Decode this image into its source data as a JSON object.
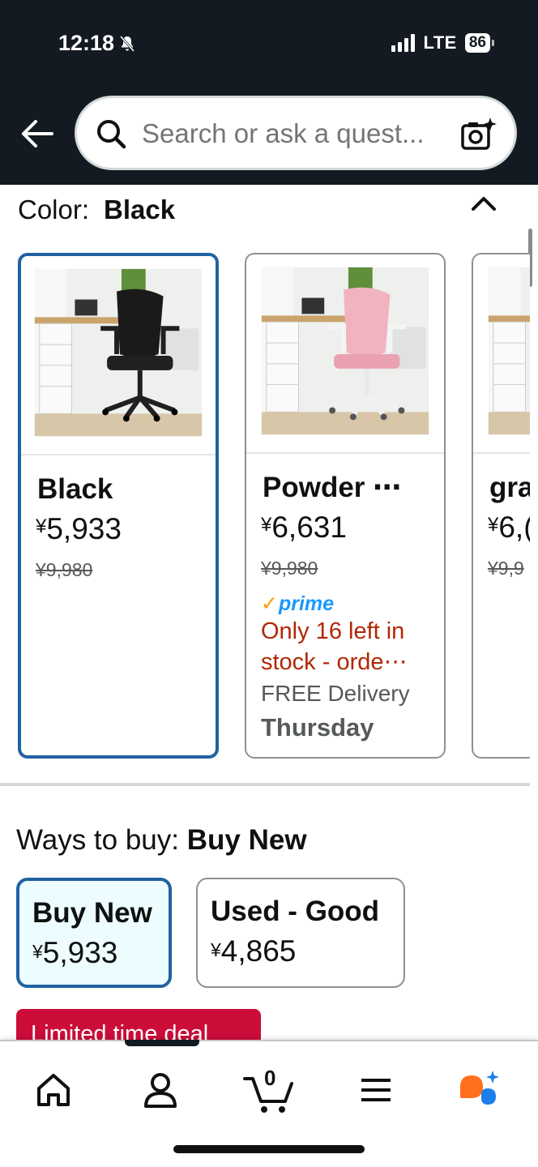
{
  "status_bar": {
    "time": "12:18",
    "network": "LTE",
    "battery": "86"
  },
  "search": {
    "placeholder": "Search or ask a quest..."
  },
  "color_selector": {
    "label": "Color:",
    "selected_value": "Black",
    "options": [
      {
        "name": "Black",
        "price_symbol": "¥",
        "price": "5,933",
        "list_price": "¥9,980",
        "selected": true
      },
      {
        "name": "Powder ⋯",
        "price_symbol": "¥",
        "price": "6,631",
        "list_price": "¥9,980",
        "prime": "prime",
        "prime_check": "✓",
        "stock_message": "Only 16 left in stock - orde⋯",
        "delivery": "FREE Delivery",
        "delivery_day": "Thursday",
        "selected": false
      },
      {
        "name": "gra",
        "price_symbol": "¥",
        "price": "6,(",
        "list_price": "¥9,9",
        "selected": false
      }
    ]
  },
  "ways_to_buy": {
    "label": "Ways to buy:",
    "selected_value": "Buy New",
    "options": [
      {
        "label": "Buy New",
        "price_symbol": "¥",
        "price": "5,933",
        "selected": true
      },
      {
        "label": "Used - Good",
        "price_symbol": "¥",
        "price": "4,865",
        "selected": false
      }
    ]
  },
  "deal_badge": "Limited time deal",
  "bottom_nav": {
    "cart_count": "0",
    "items": [
      "home-icon",
      "account-icon",
      "cart-icon",
      "menu-icon",
      "rufus-assistant-icon"
    ]
  },
  "colors": {
    "header_bg": "#131a22",
    "selected_border": "#2162a1",
    "deal_red": "#cc0c39",
    "stock_red": "#b12704",
    "prime_blue": "#1a98ff",
    "prime_check_orange": "#ff9900"
  }
}
